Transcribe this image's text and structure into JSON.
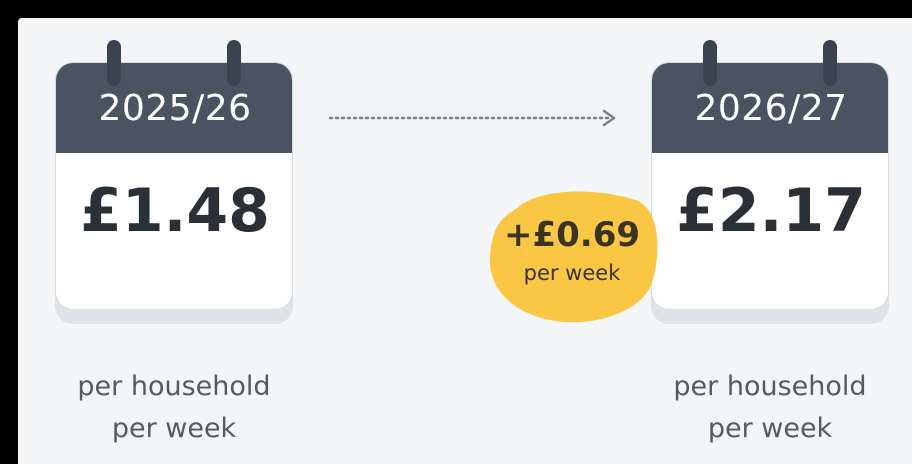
{
  "before": {
    "year": "2025/26",
    "amount": "£1.48",
    "caption_line1": "per household",
    "caption_line2": "per week"
  },
  "after": {
    "year": "2026/27",
    "amount": "£2.17",
    "caption_line1": "per household",
    "caption_line2": "per week"
  },
  "increase": {
    "amount": "+£0.69",
    "unit": "per week"
  },
  "colors": {
    "calendar_header": "#4b5363",
    "badge": "#f9c743",
    "arrow": "#7a7f88"
  }
}
